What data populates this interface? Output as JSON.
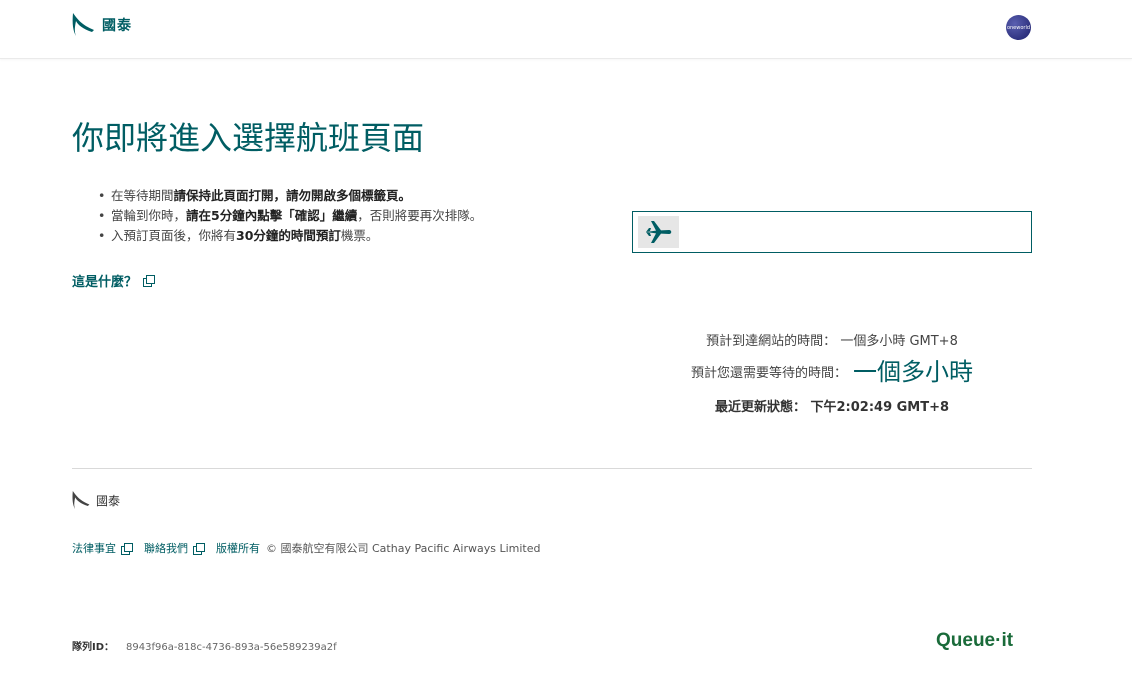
{
  "header": {
    "brand": "國泰",
    "oneworld": "oneworld"
  },
  "main": {
    "title": "你即將進入選擇航班頁面",
    "bullets": [
      {
        "pre": "在等待期間",
        "bold": "請保持此頁面打開，請勿開啟多個標籤頁。",
        "post": ""
      },
      {
        "pre": "當輪到你時，",
        "bold": "請在5分鐘內點擊「確認」繼續",
        "post": "，否則將要再次排隊。"
      },
      {
        "pre": "入預訂頁面後，你將有",
        "bold": "30分鐘的時間預訂",
        "post": "機票。"
      }
    ],
    "what_is_link": "這是什麼？"
  },
  "status": {
    "arrival_label": "預計到達網站的時間：",
    "arrival_value": "一個多小時 GMT+8",
    "wait_label": "預計您還需要等待的時間：",
    "wait_value": "一個多小時",
    "updated_label": "最近更新狀態：",
    "updated_value": "下午2:02:49 GMT+8"
  },
  "footer": {
    "brand": "國泰",
    "links": [
      "法律事宜",
      "聯絡我們"
    ],
    "copyright_link": "版權所有",
    "copyright_text": "© 國泰航空有限公司 Cathay Pacific Airways Limited",
    "queue_id_label": "隊列ID：",
    "queue_id_value": "8943f96a-818c-4736-893a-56e589239a2f",
    "queueit": "Queue·it"
  },
  "colors": {
    "accent": "#005d63",
    "queueit_green": "#1a6b3a"
  }
}
